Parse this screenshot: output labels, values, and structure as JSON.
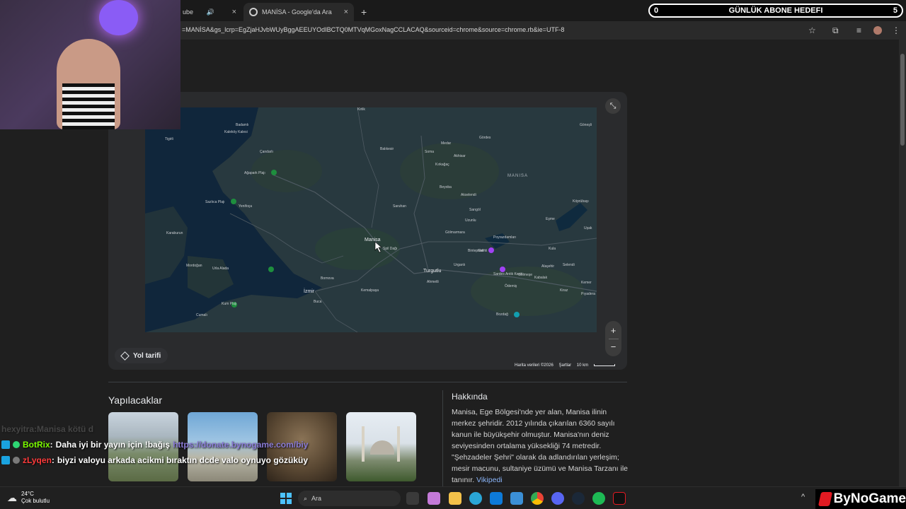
{
  "browser": {
    "tabs": [
      {
        "label": "ube",
        "audio_icon": "speaker-icon"
      },
      {
        "label": "MANİSA - Google'da Ara"
      }
    ],
    "url": "=MANİSA&gs_lcrp=EgZjaHJvbWUyBggAEEUYOdIBCTQ0MTVqMGoxNagCCLACAQ&sourceid=chrome&source=chrome.rb&ie=UTF-8",
    "new_tab": "+"
  },
  "overlay": {
    "goal": {
      "left": "0",
      "title": "GÜNLÜK ABONE HEDEFI",
      "right": "5"
    },
    "chat": [
      {
        "user": "hexyitra",
        "user_color": "#8a8a8a",
        "sep": " : ",
        "message": "Manisa kötü d",
        "faded": true
      },
      {
        "user": "BotRix",
        "user_color": "#7cfc00",
        "sep": " : ",
        "message": "Daha iyi bir yayın için !bağış",
        "link": "https://donate.bynogame.com/biy"
      },
      {
        "user": "zLyqen",
        "user_color": "#ff3b3b",
        "sep": " : ",
        "message": "biyzi valoyu arkada acikmi bıraktın dcde valo oynuyo gözüküy"
      }
    ],
    "brand": "ByNoGame"
  },
  "map": {
    "region_label": "MANISA",
    "labels": [
      {
        "t": "Kirlik"
      },
      {
        "t": "Badamlı"
      },
      {
        "t": "Kaleköy Kalesi"
      },
      {
        "t": "Tigirli"
      },
      {
        "t": "Çandarlı"
      },
      {
        "t": "Ağapark Plajı"
      },
      {
        "t": "Sazlıca Plajı"
      },
      {
        "t": "Yenifoça"
      },
      {
        "t": "Karaburun"
      },
      {
        "t": "Mordoğan"
      },
      {
        "t": "Urla Alada"
      },
      {
        "t": "Kum Plajı"
      },
      {
        "t": "Cumalı"
      },
      {
        "t": "Balıkesir"
      },
      {
        "t": "Saruhan"
      },
      {
        "t": "Medar"
      },
      {
        "t": "Akhisar"
      },
      {
        "t": "Gördes"
      },
      {
        "t": "Kırkağaç"
      },
      {
        "t": "Soma"
      },
      {
        "t": "Beyoba"
      },
      {
        "t": "Akselendi"
      },
      {
        "t": "Sarıgöl"
      },
      {
        "t": "Uzunlu"
      },
      {
        "t": "Gölmarmara"
      },
      {
        "t": "Manisa",
        "big": true
      },
      {
        "t": "Spil Dağı"
      },
      {
        "t": "Turgutlu",
        "big": true
      },
      {
        "t": "İzmir",
        "big": true
      },
      {
        "t": "Bornova"
      },
      {
        "t": "Buca"
      },
      {
        "t": "Kemalpaşa"
      },
      {
        "t": "Ahmetli"
      },
      {
        "t": "Urganlı"
      },
      {
        "t": "Salihli"
      },
      {
        "t": "Poyrazdamları"
      },
      {
        "t": "Bintepeler"
      },
      {
        "t": "Sardes Antik Kenti"
      },
      {
        "t": "Kula"
      },
      {
        "t": "Alaşehir"
      },
      {
        "t": "Selendi"
      },
      {
        "t": "Gölmeşe"
      },
      {
        "t": "Kabalak"
      },
      {
        "t": "Ödemiş"
      },
      {
        "t": "Bozdağ"
      },
      {
        "t": "Kiraz"
      },
      {
        "t": "Kemer"
      },
      {
        "t": "Pıyadera"
      },
      {
        "t": "Uşak"
      },
      {
        "t": "Eşme"
      },
      {
        "t": "Köprübaşı"
      },
      {
        "t": "Göneşli"
      }
    ],
    "route_button": "Yol tarifi",
    "footer": [
      "Harita verileri ©2026",
      "Şartlar",
      "10 km"
    ],
    "zoom_in": "+",
    "zoom_out": "−"
  },
  "things_to_do": {
    "title": "Yapılacaklar"
  },
  "about": {
    "title": "Hakkında",
    "body": "Manisa, Ege Bölgesi'nde yer alan, Manisa ilinin merkez şehridir. 2012 yılında çıkarılan 6360 sayılı kanun ile büyükşehir olmuştur. Manisa'nın deniz seviyesinden ortalama yüksekliği 74 metredir. \"Şehzadeler Şehri\" olarak da adlandırılan yerleşim; mesir macunu, sultaniye üzümü ve Manisa Tarzanı ile tanınır.",
    "link": "Vikipedi"
  },
  "taskbar": {
    "temperature": "24°C",
    "condition": "Çok bulutlu",
    "search_placeholder": "Ara"
  }
}
